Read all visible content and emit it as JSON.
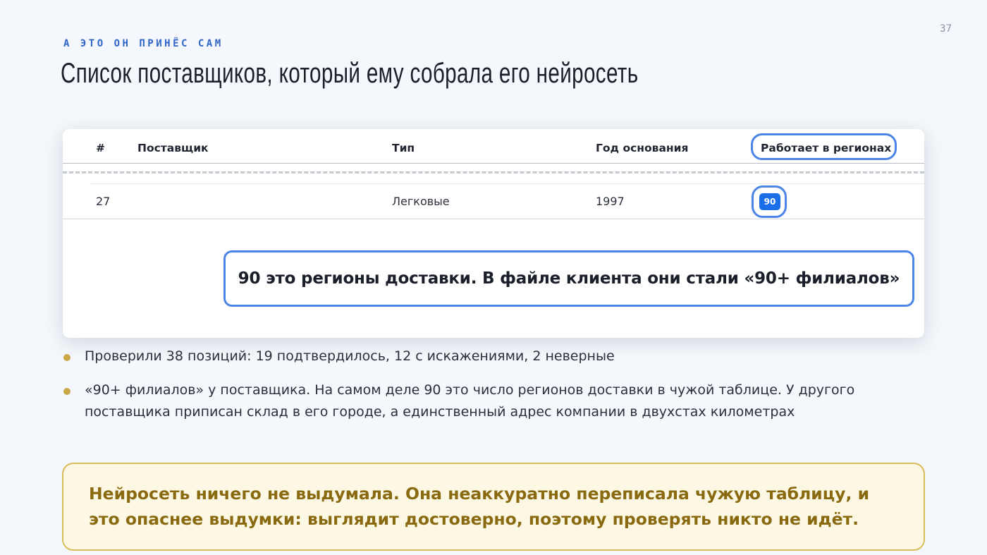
{
  "slide": {
    "page_number": "37",
    "kicker": "А ЭТО ОН ПРИНЁС САМ",
    "title": "Список поставщиков, который ему собрала его нейросеть"
  },
  "table": {
    "headers": {
      "num": "#",
      "supplier": "Поставщик",
      "type": "Тип",
      "year": "Год основания",
      "regions": "Работает в регионах"
    },
    "row": {
      "num": "27",
      "supplier": "",
      "type": "Легковые",
      "year": "1997",
      "regions": "90"
    },
    "callout": "90 это регионы доставки. В файле клиента они стали «90+ филиалов»",
    "highlight_color": "#4b86e6",
    "badge_color": "#1a6ee8"
  },
  "bullets": [
    {
      "text": "Проверили 38 позиций: 19 подтвердилось, 12 с искажениями, 2 неверные"
    },
    {
      "line1": "«90+ филиалов» у поставщика. На самом деле 90 это число регионов доставки в чужой таблице. У другого",
      "line2": "поставщика приписан склад в его городе, а единственный адрес компании в двухстах километрах"
    }
  ],
  "note": {
    "line1": "Нейросеть ничего не выдумала. Она неаккуратно переписала чужую таблицу, и",
    "line2": "это опаснее выдумки: выглядит достоверно, поэтому проверять никто не идёт.",
    "text_color": "#8a6a10",
    "border_color": "#d8bd5b",
    "bullet_color": "#c9a84a"
  }
}
